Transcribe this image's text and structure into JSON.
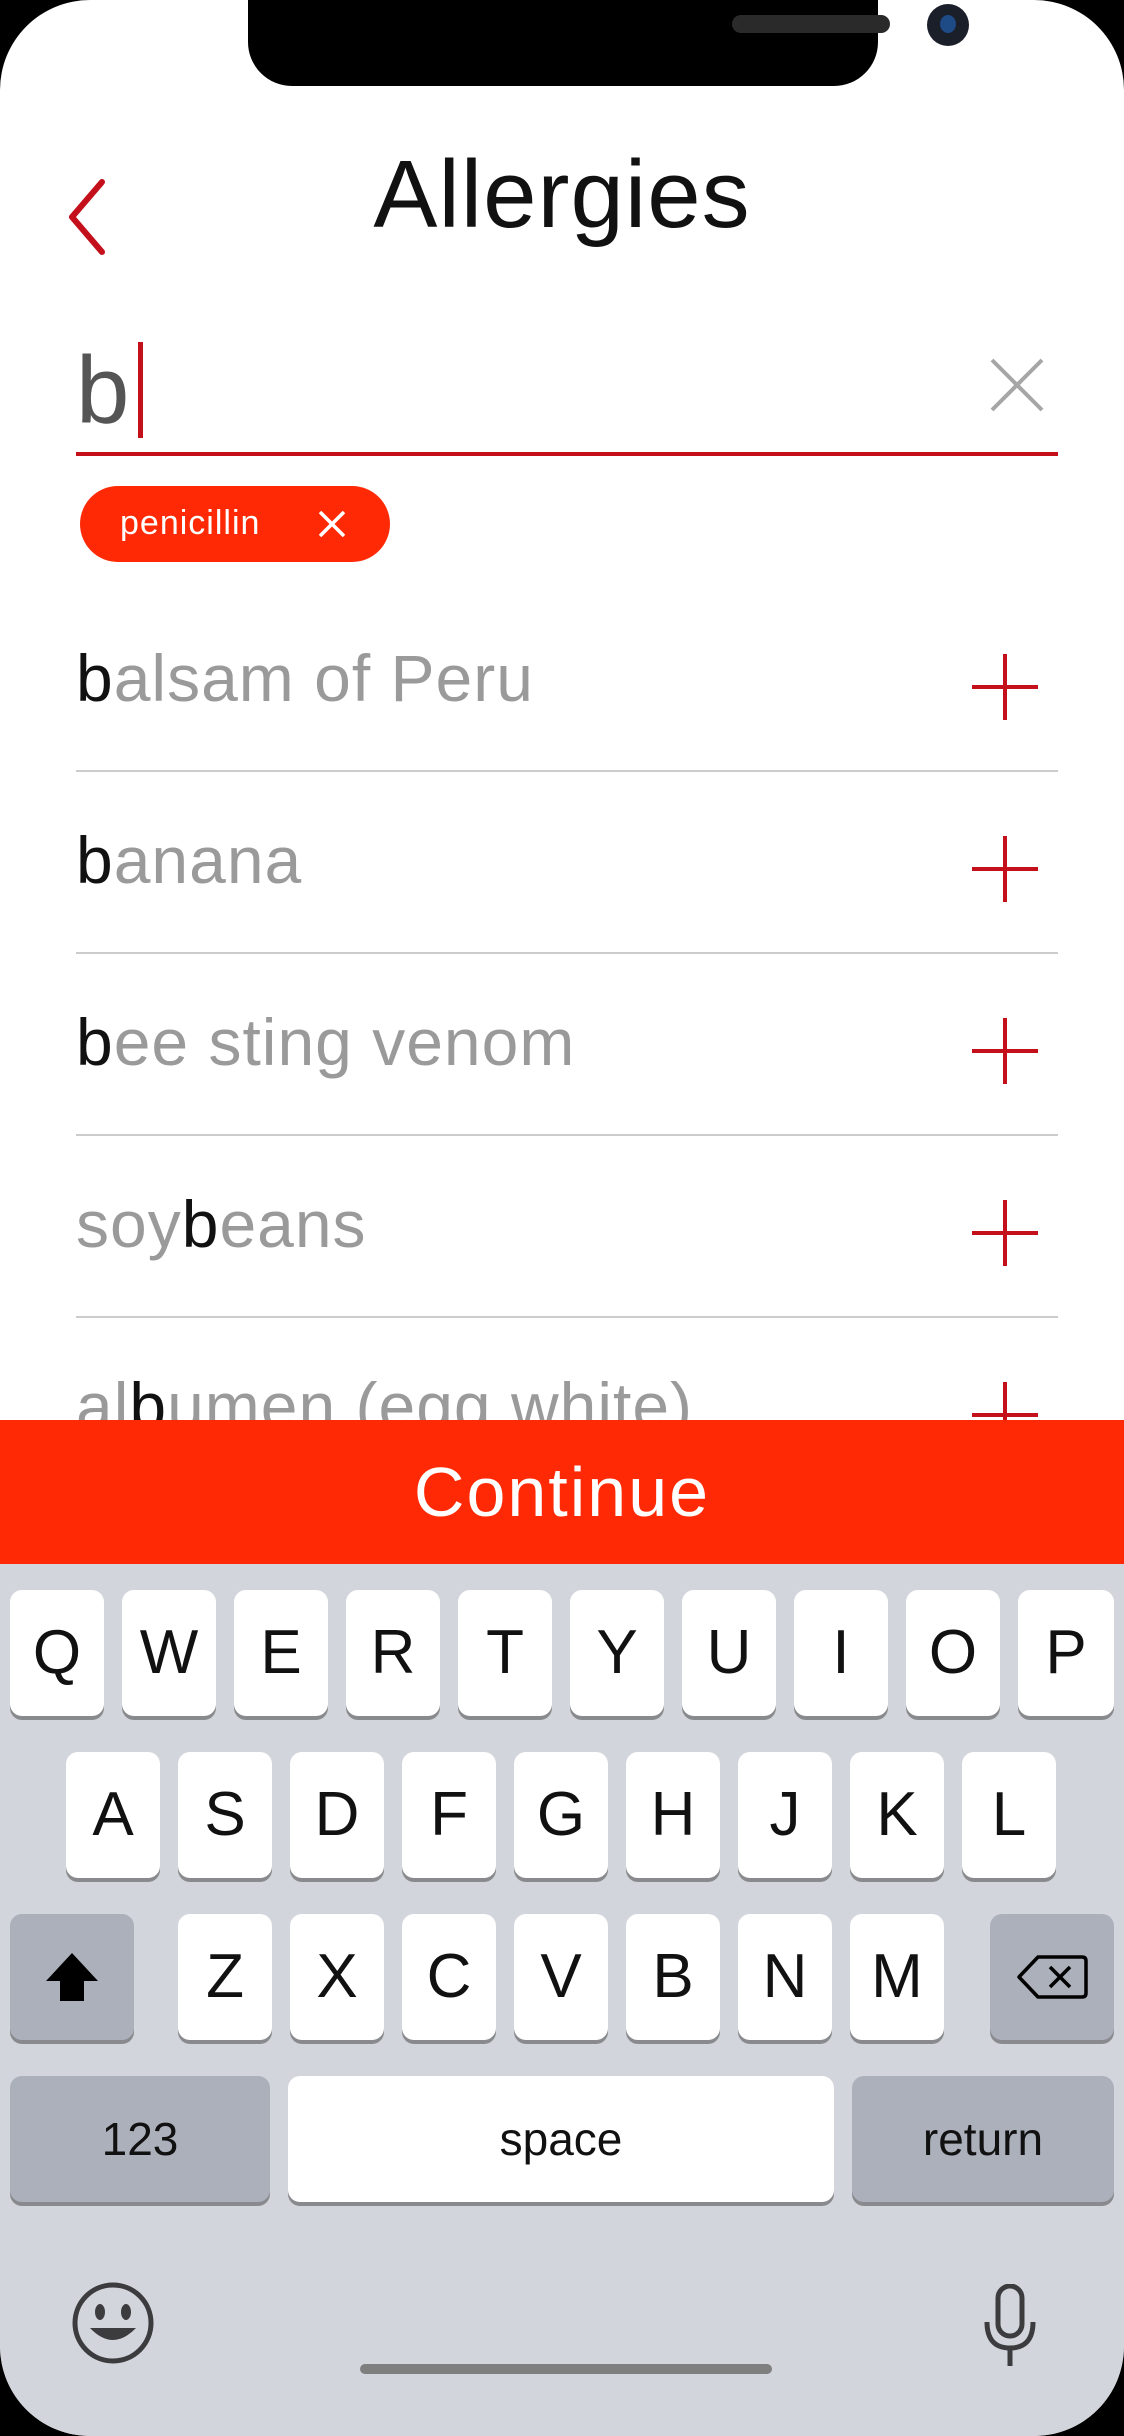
{
  "header": {
    "title": "Allergies"
  },
  "search": {
    "value": "b"
  },
  "selected_chips": [
    {
      "label": "penicillin"
    }
  ],
  "results": [
    {
      "pre": "",
      "match": "b",
      "post": "alsam of Peru"
    },
    {
      "pre": "",
      "match": "b",
      "post": "anana"
    },
    {
      "pre": "",
      "match": "b",
      "post": "ee sting venom"
    },
    {
      "pre": "soy",
      "match": "b",
      "post": "eans"
    },
    {
      "pre": "al",
      "match": "b",
      "post": "umen (egg white)"
    }
  ],
  "continue_label": "Continue",
  "keyboard": {
    "row1": [
      "Q",
      "W",
      "E",
      "R",
      "T",
      "Y",
      "U",
      "I",
      "O",
      "P"
    ],
    "row2": [
      "A",
      "S",
      "D",
      "F",
      "G",
      "H",
      "J",
      "K",
      "L"
    ],
    "row3": [
      "Z",
      "X",
      "C",
      "V",
      "B",
      "N",
      "M"
    ],
    "numbers_label": "123",
    "space_label": "space",
    "return_label": "return"
  },
  "colors": {
    "accent": "#c4101a",
    "brand": "#ff2a05",
    "muted_text": "#9a9a9a",
    "keyboard_bg": "#d2d5db"
  },
  "icons": {
    "back": "chevron-left-icon",
    "clear": "close-icon",
    "chip_remove": "close-icon",
    "add": "plus-icon",
    "shift": "shift-icon",
    "backspace": "backspace-icon",
    "emoji": "emoji-icon",
    "mic": "microphone-icon"
  }
}
